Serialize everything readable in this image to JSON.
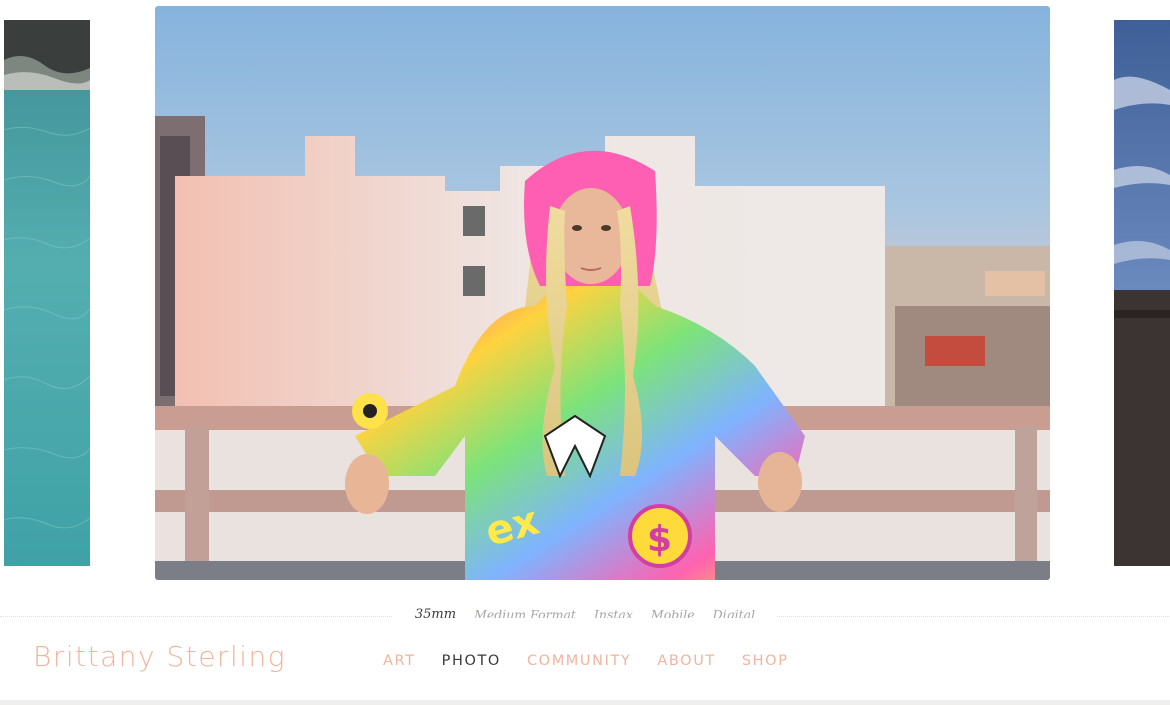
{
  "slideshow": {
    "left_image": "turquoise-water-photo",
    "main_image": "woman-in-rainbow-hoodie-rooftop-photo",
    "right_image": "sky-and-building-photo"
  },
  "subnav": {
    "items": [
      {
        "label": "35mm",
        "active": true
      },
      {
        "label": "Medium Format",
        "active": false
      },
      {
        "label": "Instax",
        "active": false
      },
      {
        "label": "Mobile",
        "active": false
      },
      {
        "label": "Digital",
        "active": false
      }
    ]
  },
  "header": {
    "brand": "Brittany Sterling",
    "nav": [
      {
        "label": "ART",
        "active": false
      },
      {
        "label": "PHOTO",
        "active": true
      },
      {
        "label": "COMMUNITY",
        "active": false
      },
      {
        "label": "ABOUT",
        "active": false
      },
      {
        "label": "SHOP",
        "active": false
      }
    ]
  },
  "colors": {
    "brand": "#f1b49f",
    "nav_active": "#3a3a3a",
    "subnav_inactive": "#a8a4a2"
  }
}
